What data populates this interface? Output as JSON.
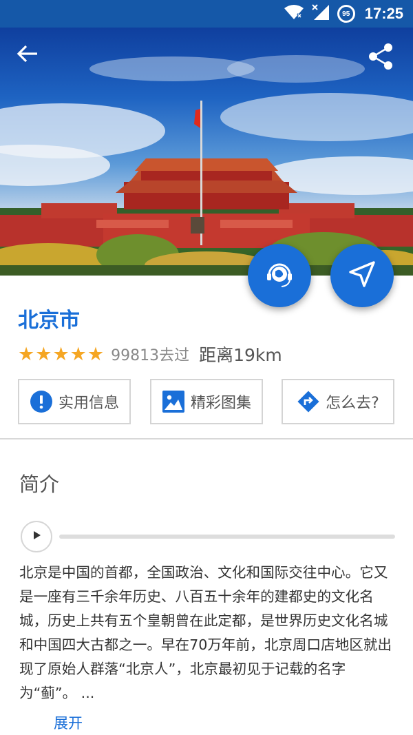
{
  "status_bar": {
    "time": "17:25",
    "battery": "95",
    "icons": [
      "wifi-icon",
      "signal-icon",
      "battery-icon"
    ]
  },
  "hero": {
    "back_icon": "arrow-left-icon",
    "share_icon": "share-icon"
  },
  "fabs": {
    "audio_guide_icon": "audio-guide-icon",
    "navigate_icon": "navigation-arrow-icon"
  },
  "place": {
    "name": "北京市",
    "rating_stars": 5,
    "visits": "99813去过",
    "distance": "距离19km"
  },
  "actions": [
    {
      "label": "实用信息",
      "icon": "info-icon"
    },
    {
      "label": "精彩图集",
      "icon": "gallery-icon"
    },
    {
      "label": "怎么去?",
      "icon": "directions-icon"
    }
  ],
  "intro": {
    "heading": "简介",
    "text": "北京是中国的首都，全国政治、文化和国际交往中心。它又是一座有三千余年历史、八百五十余年的建都史的文化名城，历史上共有五个皇朝曾在此定都，是世界历史文化名城和中国四大古都之一。早在70万年前，北京周口店地区就出现了原始人群落“北京人”，北京最初见于记载的名字为“蓟”。 ...",
    "expand": "展开"
  },
  "colors": {
    "accent": "#1a6fd8",
    "status_bar": "#1558a8",
    "star": "#f5a623"
  }
}
